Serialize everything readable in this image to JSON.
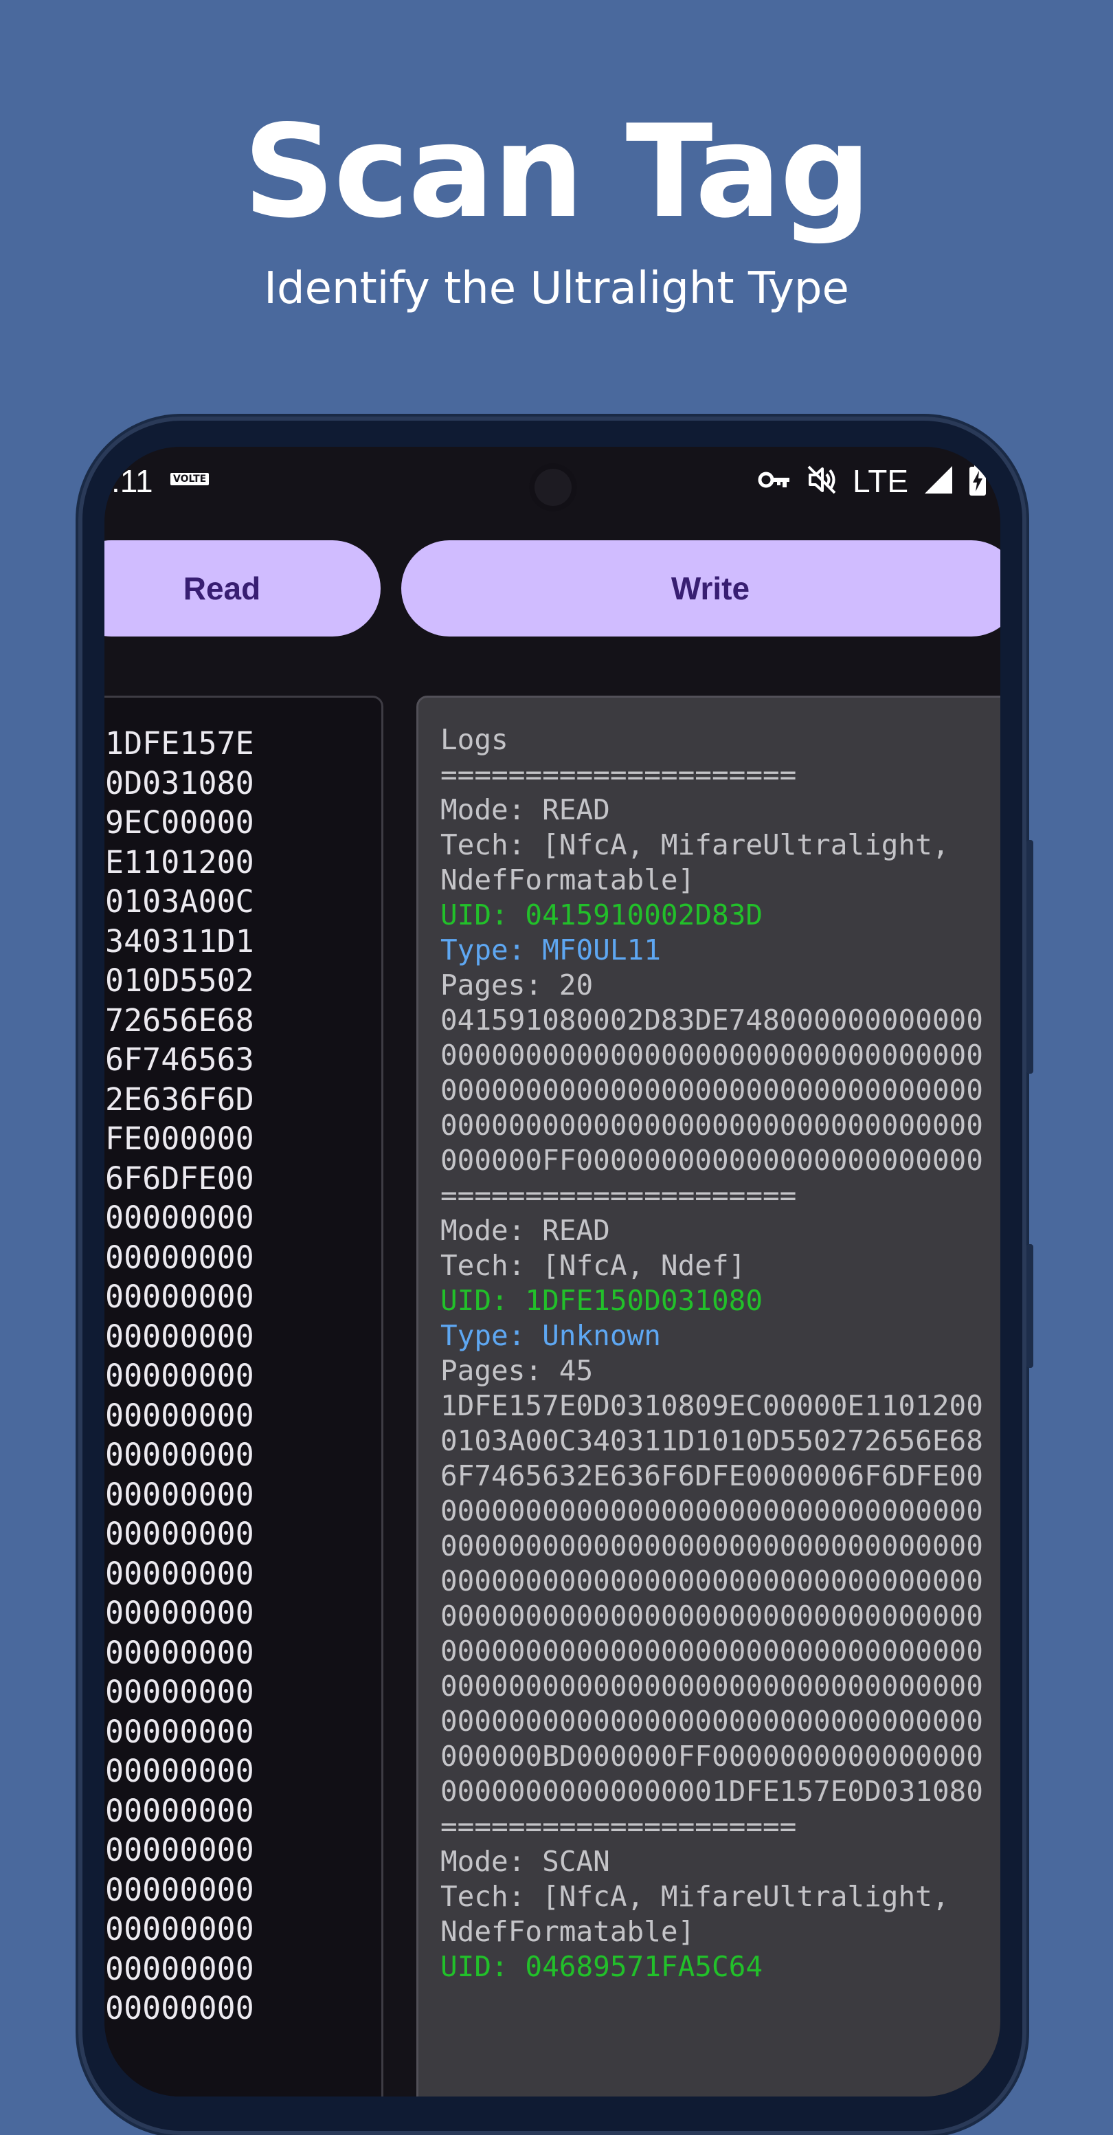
{
  "promo": {
    "title": "Scan Tag",
    "subtitle": "Identify the Ultralight Type"
  },
  "status_bar": {
    "time": ".11",
    "volte": "VOLTE",
    "network": "LTE",
    "icons": [
      "vpn-key-icon",
      "mute-icon",
      "signal-icon",
      "battery-charging-icon"
    ]
  },
  "actions": {
    "read_label": "Read",
    "write_label": "Write"
  },
  "memory_dump": {
    "rows": [
      "1DFE157E",
      "0D031080",
      "9EC00000",
      "E1101200",
      "0103A00C",
      "340311D1",
      "010D5502",
      "72656E68",
      "6F746563",
      "2E636F6D",
      "FE000000",
      "6F6DFE00",
      "00000000",
      "00000000",
      "00000000",
      "00000000",
      "00000000",
      "00000000",
      "00000000",
      "00000000",
      "00000000",
      "00000000",
      "00000000",
      "00000000",
      "00000000",
      "00000000",
      "00000000",
      "00000000",
      "00000000",
      "00000000",
      "00000000",
      "00000000",
      "00000000"
    ]
  },
  "logs": {
    "lines": [
      {
        "text": "Logs",
        "style": "normal"
      },
      {
        "text": "=====================",
        "style": "normal"
      },
      {
        "text": "Mode: READ",
        "style": "normal"
      },
      {
        "text": "Tech: [NfcA, MifareUltralight,",
        "style": "normal"
      },
      {
        "text": "NdefFormatable]",
        "style": "normal"
      },
      {
        "text": "UID: 0415910002D83D",
        "style": "green"
      },
      {
        "text": "Type: MF0UL11",
        "style": "blue"
      },
      {
        "text": "Pages: 20",
        "style": "normal"
      },
      {
        "text": "041591080002D83DE748000000000000",
        "style": "normal"
      },
      {
        "text": "00000000000000000000000000000000",
        "style": "normal"
      },
      {
        "text": "00000000000000000000000000000000",
        "style": "normal"
      },
      {
        "text": "00000000000000000000000000000000",
        "style": "normal"
      },
      {
        "text": "000000FF000000000000000000000000",
        "style": "normal"
      },
      {
        "text": "=====================",
        "style": "normal"
      },
      {
        "text": "Mode: READ",
        "style": "normal"
      },
      {
        "text": "Tech: [NfcA, Ndef]",
        "style": "normal"
      },
      {
        "text": "UID: 1DFE150D031080",
        "style": "green"
      },
      {
        "text": "Type: Unknown",
        "style": "blue"
      },
      {
        "text": "Pages: 45",
        "style": "normal"
      },
      {
        "text": "1DFE157E0D0310809EC00000E1101200",
        "style": "normal"
      },
      {
        "text": "0103A00C340311D1010D550272656E68",
        "style": "normal"
      },
      {
        "text": "6F7465632E636F6DFE0000006F6DFE00",
        "style": "normal"
      },
      {
        "text": "00000000000000000000000000000000",
        "style": "normal"
      },
      {
        "text": "00000000000000000000000000000000",
        "style": "normal"
      },
      {
        "text": "00000000000000000000000000000000",
        "style": "normal"
      },
      {
        "text": "00000000000000000000000000000000",
        "style": "normal"
      },
      {
        "text": "00000000000000000000000000000000",
        "style": "normal"
      },
      {
        "text": "00000000000000000000000000000000",
        "style": "normal"
      },
      {
        "text": "00000000000000000000000000000000",
        "style": "normal"
      },
      {
        "text": "000000BD000000FF0000000000000000",
        "style": "normal"
      },
      {
        "text": "00000000000000001DFE157E0D031080",
        "style": "normal"
      },
      {
        "text": "=====================",
        "style": "normal"
      },
      {
        "text": "Mode: SCAN",
        "style": "normal"
      },
      {
        "text": "Tech: [NfcA, MifareUltralight,",
        "style": "normal"
      },
      {
        "text": "NdefFormatable]",
        "style": "normal"
      },
      {
        "text": "UID: 04689571FA5C64",
        "style": "green"
      }
    ]
  },
  "colors": {
    "page_background": "#4a699d",
    "screen_background": "#141218",
    "button_fill": "#d0bcff",
    "button_text": "#381e72",
    "log_panel": "#3c3b40",
    "uid_green": "#22c02a",
    "type_blue": "#5ea7f2"
  }
}
